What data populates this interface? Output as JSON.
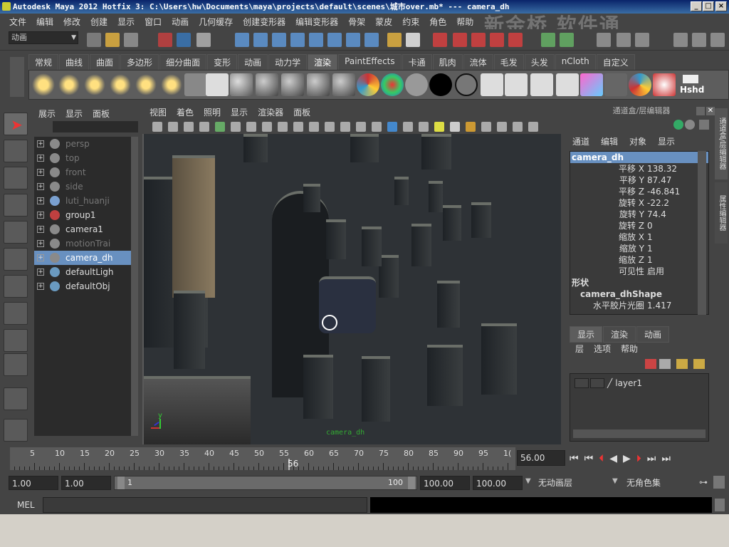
{
  "title": "Autodesk Maya 2012 Hotfix 3: C:\\Users\\hw\\Documents\\maya\\projects\\default\\scenes\\城市over.mb*   ---   camera_dh",
  "watermark": "新金桥 软件通",
  "menubar": [
    "文件",
    "编辑",
    "修改",
    "创建",
    "显示",
    "窗口",
    "动画",
    "几何缓存",
    "创建变形器",
    "编辑变形器",
    "骨架",
    "蒙皮",
    "约束",
    "角色",
    "帮助"
  ],
  "mode_selector": "动画",
  "shelf_tabs": [
    "常规",
    "曲线",
    "曲面",
    "多边形",
    "细分曲面",
    "变形",
    "动画",
    "动力学",
    "渲染",
    "PaintEffects",
    "卡通",
    "肌肉",
    "流体",
    "毛发",
    "头发",
    "nCloth",
    "自定义"
  ],
  "active_shelf_tab": "渲染",
  "shelf_last_label": "Hshd",
  "outliner": {
    "menu": [
      "展示",
      "显示",
      "面板"
    ],
    "items": [
      {
        "label": "persp",
        "dim": true
      },
      {
        "label": "top",
        "dim": true
      },
      {
        "label": "front",
        "dim": true
      },
      {
        "label": "side",
        "dim": true
      },
      {
        "label": "luti_huanji",
        "dim": true
      },
      {
        "label": "group1",
        "dim": false
      },
      {
        "label": "camera1",
        "dim": false
      },
      {
        "label": "motionTrai",
        "dim": true
      },
      {
        "label": "camera_dh",
        "dim": false,
        "selected": true
      },
      {
        "label": "defaultLigh",
        "dim": false
      },
      {
        "label": "defaultObj",
        "dim": false
      }
    ]
  },
  "viewport": {
    "menu": [
      "视图",
      "着色",
      "照明",
      "显示",
      "渲染器",
      "面板"
    ],
    "camera_label": "camera_dh"
  },
  "channelbox": {
    "header": "通道盒/层编辑器",
    "menu": [
      "通道",
      "编辑",
      "对象",
      "显示"
    ],
    "object": "camera_dh",
    "channels": [
      {
        "name": "平移 X",
        "value": "138.32"
      },
      {
        "name": "平移 Y",
        "value": "87.47"
      },
      {
        "name": "平移 Z",
        "value": "-46.841"
      },
      {
        "name": "旋转 X",
        "value": "-22.2"
      },
      {
        "name": "旋转 Y",
        "value": "74.4"
      },
      {
        "name": "旋转 Z",
        "value": "0"
      },
      {
        "name": "缩放 X",
        "value": "1"
      },
      {
        "name": "缩放 Y",
        "value": "1"
      },
      {
        "name": "缩放 Z",
        "value": "1"
      },
      {
        "name": "可见性",
        "value": "启用"
      }
    ],
    "shapes_label": "形状",
    "shape_name": "camera_dhShape",
    "shape_channel": {
      "name": "水平胶片光圈",
      "value": "1.417"
    },
    "side_tabs": [
      "通道盒/层编辑器",
      "属性编辑器"
    ]
  },
  "layer_editor": {
    "tabs": [
      "显示",
      "渲染",
      "动画"
    ],
    "menu": [
      "层",
      "选项",
      "帮助"
    ],
    "layer": "layer1"
  },
  "timeline": {
    "ticks": [
      "5",
      "10",
      "15",
      "20",
      "25",
      "30",
      "35",
      "40",
      "45",
      "50",
      "55",
      "60",
      "65",
      "70",
      "75",
      "80",
      "85",
      "90",
      "95",
      "1("
    ],
    "current_frame": "56",
    "current_time_field": "56.00"
  },
  "range": {
    "start": "1.00",
    "anim_start": "1.00",
    "slider_start": "1",
    "slider_end": "100",
    "anim_end": "100.00",
    "end": "100.00",
    "anim_layer": "无动画层",
    "char_set": "无角色集"
  },
  "cmd": {
    "label": "MEL"
  }
}
